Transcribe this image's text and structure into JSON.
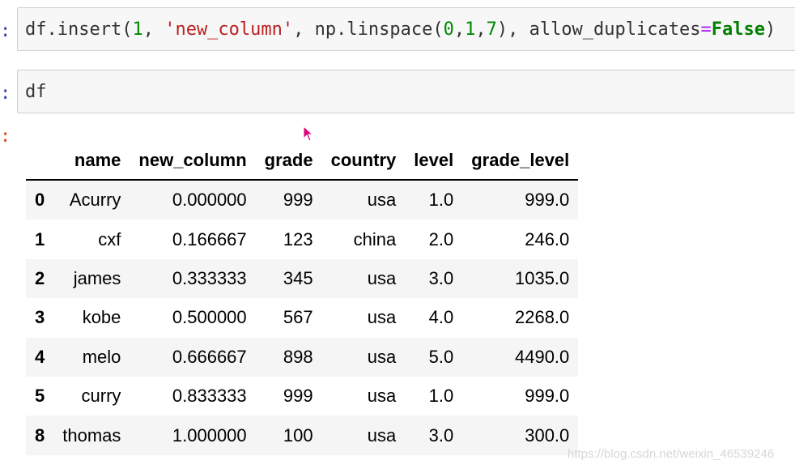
{
  "cells": [
    {
      "prompt": ":",
      "code_tokens": [
        {
          "text": "df.insert(",
          "cls": ""
        },
        {
          "text": "1",
          "cls": "tok-num"
        },
        {
          "text": ", ",
          "cls": ""
        },
        {
          "text": "'new_column'",
          "cls": "tok-str"
        },
        {
          "text": ", np.linspace(",
          "cls": ""
        },
        {
          "text": "0",
          "cls": "tok-num"
        },
        {
          "text": ",",
          "cls": ""
        },
        {
          "text": "1",
          "cls": "tok-num"
        },
        {
          "text": ",",
          "cls": ""
        },
        {
          "text": "7",
          "cls": "tok-num"
        },
        {
          "text": "), allow_duplicates",
          "cls": ""
        },
        {
          "text": "=",
          "cls": "tok-op"
        },
        {
          "text": "False",
          "cls": "tok-kw"
        },
        {
          "text": ")",
          "cls": ""
        }
      ]
    },
    {
      "prompt": ":",
      "code_tokens": [
        {
          "text": "df",
          "cls": ""
        }
      ]
    }
  ],
  "output": {
    "prompt": ":",
    "table": {
      "columns": [
        "",
        "name",
        "new_column",
        "grade",
        "country",
        "level",
        "grade_level"
      ],
      "rows": [
        {
          "index": "0",
          "values": [
            "Acurry",
            "0.000000",
            "999",
            "usa",
            "1.0",
            "999.0"
          ]
        },
        {
          "index": "1",
          "values": [
            "cxf",
            "0.166667",
            "123",
            "china",
            "2.0",
            "246.0"
          ]
        },
        {
          "index": "2",
          "values": [
            "james",
            "0.333333",
            "345",
            "usa",
            "3.0",
            "1035.0"
          ]
        },
        {
          "index": "3",
          "values": [
            "kobe",
            "0.500000",
            "567",
            "usa",
            "4.0",
            "2268.0"
          ]
        },
        {
          "index": "4",
          "values": [
            "melo",
            "0.666667",
            "898",
            "usa",
            "5.0",
            "4490.0"
          ]
        },
        {
          "index": "5",
          "values": [
            "curry",
            "0.833333",
            "999",
            "usa",
            "1.0",
            "999.0"
          ]
        },
        {
          "index": "8",
          "values": [
            "thomas",
            "1.000000",
            "100",
            "usa",
            "3.0",
            "300.0"
          ]
        }
      ]
    }
  },
  "watermark": "https://blog.csdn.net/weixin_46539246",
  "colors": {
    "cursor": "#e0007a"
  }
}
